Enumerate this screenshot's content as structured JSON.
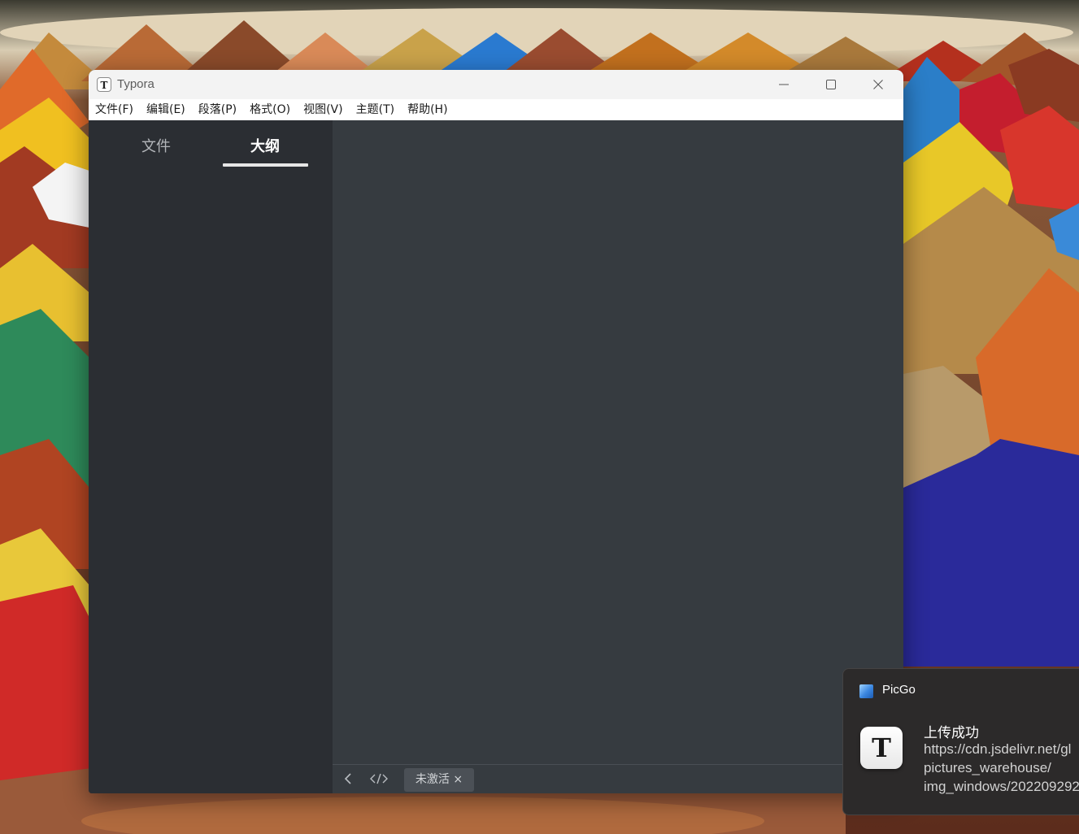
{
  "desktop": {
    "wallpaper": "pigment-cones"
  },
  "window": {
    "title": "Typora",
    "icon_letter": "T",
    "controls": [
      "minimize-icon",
      "maximize-icon",
      "close-icon"
    ]
  },
  "menubar": {
    "items": [
      "文件(F)",
      "编辑(E)",
      "段落(P)",
      "格式(O)",
      "视图(V)",
      "主题(T)",
      "帮助(H)"
    ]
  },
  "sidebar": {
    "tabs": [
      {
        "label": "文件",
        "active": false
      },
      {
        "label": "大纲",
        "active": true
      }
    ]
  },
  "statusbar": {
    "back_icon": "chevron-left-icon",
    "source_icon": "code-icon",
    "badge": "未激活 ×"
  },
  "notification": {
    "app_name": "PicGo",
    "logo_letter": "T",
    "title": "上传成功",
    "lines": [
      "https://cdn.jsdelivr.net/gl",
      "pictures_warehouse/",
      "img_windows/202209292"
    ]
  },
  "colors": {
    "sidebar_bg": "#2b2e33",
    "editor_bg": "#363b40",
    "titlebar_bg": "#f3f3f3",
    "toast_bg": "#2c2a2a"
  }
}
